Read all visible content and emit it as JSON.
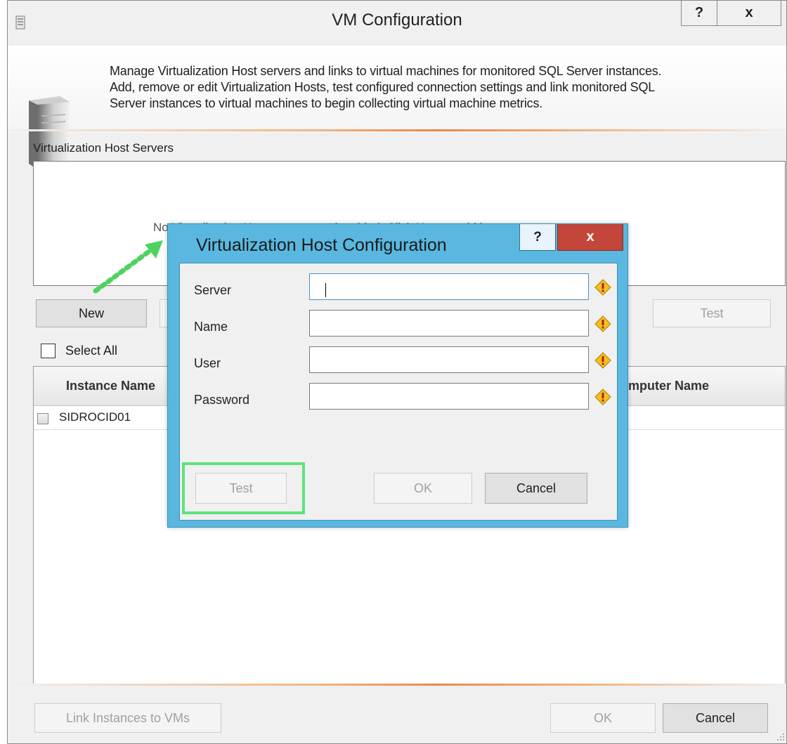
{
  "main_window": {
    "title": "VM Configuration",
    "help_label": "?",
    "close_label": "x",
    "description": [
      "Manage Virtualization Host servers and links to virtual machines for monitored SQL Server instances.",
      "Add, remove or edit Virtualization Hosts, test configured connection settings and link monitored SQL",
      "Server instances to virtual machines to begin collecting virtual machine metrics."
    ],
    "hosts_label": "Virtualization Host Servers",
    "hosts_empty_text": "No Virtualization Hosts are currently added. Click New to add hosts.",
    "new_label": "New",
    "test_label": "Test",
    "select_all_label": "Select All",
    "grid": {
      "columns": [
        "Instance Name",
        "Computer Name"
      ],
      "rows": [
        {
          "instance_name": "SIDROCID01",
          "checked": false
        }
      ]
    },
    "link_label": "Link Instances to VMs",
    "ok_label": "OK",
    "cancel_label": "Cancel"
  },
  "dialog": {
    "title": "Virtualization Host Configuration",
    "help_label": "?",
    "close_label": "x",
    "fields": [
      {
        "label": "Server",
        "value": ""
      },
      {
        "label": "Name",
        "value": ""
      },
      {
        "label": "User",
        "value": ""
      },
      {
        "label": "Password",
        "value": ""
      }
    ],
    "test_label": "Test",
    "ok_label": "OK",
    "cancel_label": "Cancel"
  },
  "icons": [
    "app-icon",
    "server-tower-icon",
    "warning-icon",
    "dotted-arrow-icon",
    "resize-grip-icon"
  ],
  "colors": {
    "dialog_frame": "#5ab8e0",
    "close_red": "#c4463a",
    "highlight_green": "#5fe37a",
    "accent_orange": "#e9884a"
  }
}
